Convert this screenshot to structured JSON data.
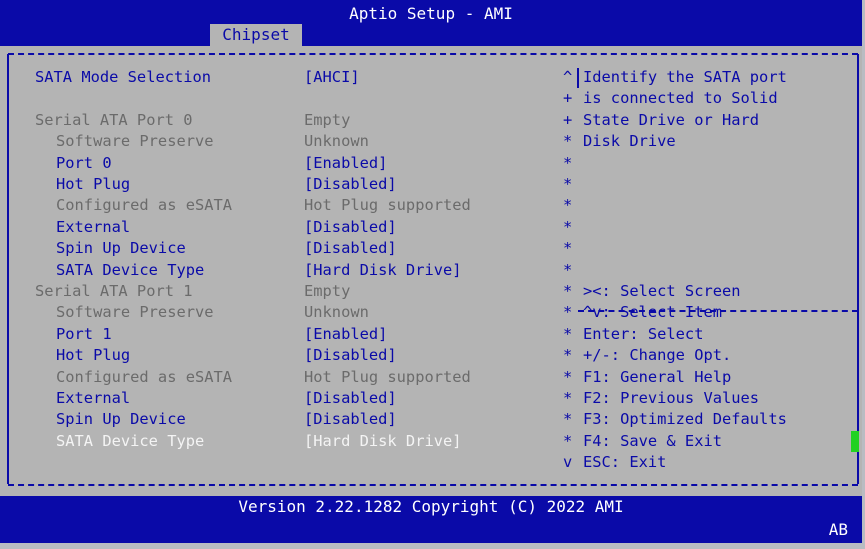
{
  "window": {
    "title": "Aptio Setup - AMI"
  },
  "tabs": [
    {
      "label": "Chipset"
    }
  ],
  "settings": [
    {
      "label": "SATA Mode Selection",
      "value": "[AHCI]",
      "state": "active",
      "indent": false
    },
    {
      "label": "Serial ATA Port 0",
      "value": "Empty",
      "state": "grey",
      "indent": false
    },
    {
      "label": "Software Preserve",
      "value": "Unknown",
      "state": "grey",
      "indent": true
    },
    {
      "label": "Port 0",
      "value": "[Enabled]",
      "state": "active",
      "indent": true
    },
    {
      "label": "Hot Plug",
      "value": "[Disabled]",
      "state": "active",
      "indent": true
    },
    {
      "label": "Configured as eSATA",
      "value": "Hot Plug supported",
      "state": "grey",
      "indent": true
    },
    {
      "label": "External",
      "value": "[Disabled]",
      "state": "active",
      "indent": true
    },
    {
      "label": "Spin Up Device",
      "value": "[Disabled]",
      "state": "active",
      "indent": true
    },
    {
      "label": "SATA Device Type",
      "value": "[Hard Disk Drive]",
      "state": "active",
      "indent": true
    },
    {
      "label": "Serial ATA Port 1",
      "value": "Empty",
      "state": "grey",
      "indent": false
    },
    {
      "label": "Software Preserve",
      "value": "Unknown",
      "state": "grey",
      "indent": true
    },
    {
      "label": "Port 1",
      "value": "[Enabled]",
      "state": "active",
      "indent": true
    },
    {
      "label": "Hot Plug",
      "value": "[Disabled]",
      "state": "active",
      "indent": true
    },
    {
      "label": "Configured as eSATA",
      "value": "Hot Plug supported",
      "state": "grey",
      "indent": true
    },
    {
      "label": "External",
      "value": "[Disabled]",
      "state": "active",
      "indent": true
    },
    {
      "label": "Spin Up Device",
      "value": "[Disabled]",
      "state": "active",
      "indent": true
    },
    {
      "label": "SATA Device Type",
      "value": "[Hard Disk Drive]",
      "state": "selected",
      "indent": true
    }
  ],
  "help": {
    "description": [
      "Identify the SATA port",
      "is connected to Solid",
      "State Drive or Hard",
      "Disk Drive"
    ],
    "keys": [
      "><: Select Screen",
      "^v: Select Item",
      "Enter: Select",
      "+/-: Change Opt.",
      "F1: General Help",
      "F2: Previous Values",
      "F3: Optimized Defaults",
      "F4: Save & Exit",
      "ESC: Exit"
    ]
  },
  "scroll_markers": [
    "^",
    "+",
    "+",
    "*",
    "*",
    "*",
    "*",
    "*",
    "*",
    "*",
    "*",
    "*",
    "*",
    "*",
    "*",
    "*",
    "*",
    "*",
    "v"
  ],
  "footer": {
    "version": "Version 2.22.1282 Copyright (C) 2022 AMI"
  },
  "corner_label": "AB",
  "colors": {
    "background": "#0a0aa8",
    "panel": "#b4b4b4",
    "active_text": "#0a0aa8",
    "grey_text": "#6b6b6b",
    "selected_text": "#f4f4f4",
    "cursor": "#22d122"
  }
}
